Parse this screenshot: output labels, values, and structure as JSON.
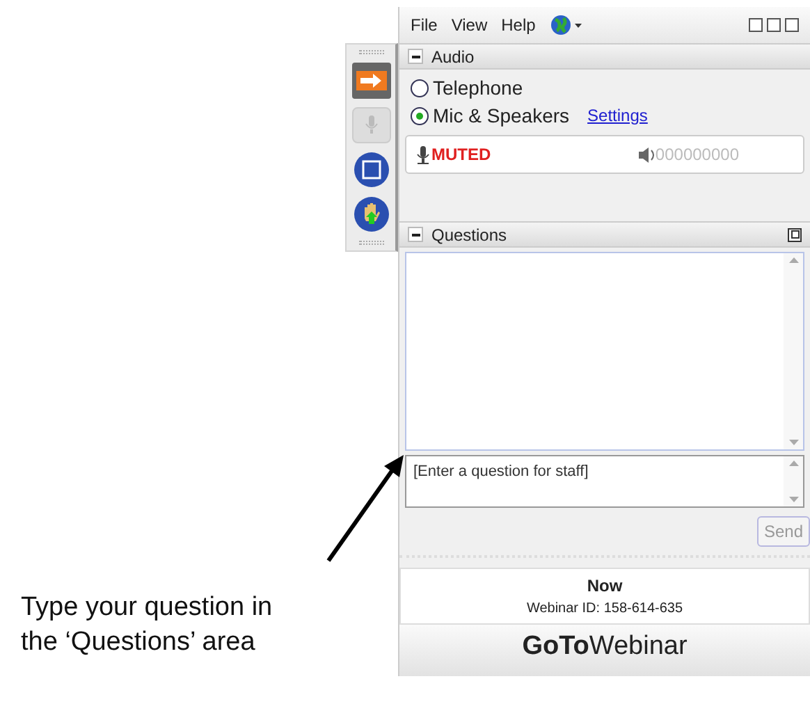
{
  "menu": [
    {
      "label": "File"
    },
    {
      "label": "View"
    },
    {
      "label": "Help"
    }
  ],
  "audio": {
    "title": "Audio",
    "options": [
      {
        "label": "Telephone",
        "selected": false
      },
      {
        "label": "Mic & Speakers",
        "selected": true
      }
    ],
    "settings_link": "Settings",
    "mic_status": "MUTED",
    "speaker_meter": "000000000"
  },
  "questions": {
    "title": "Questions",
    "placeholder": "[Enter a question for staff]",
    "send_button": "Send"
  },
  "session": {
    "status": "Now",
    "webinar_id": "Webinar ID: 158-614-635"
  },
  "logo": "**GoTo**Webinar",
  "annotation": "Type your question in the ‘Questions’ area"
}
